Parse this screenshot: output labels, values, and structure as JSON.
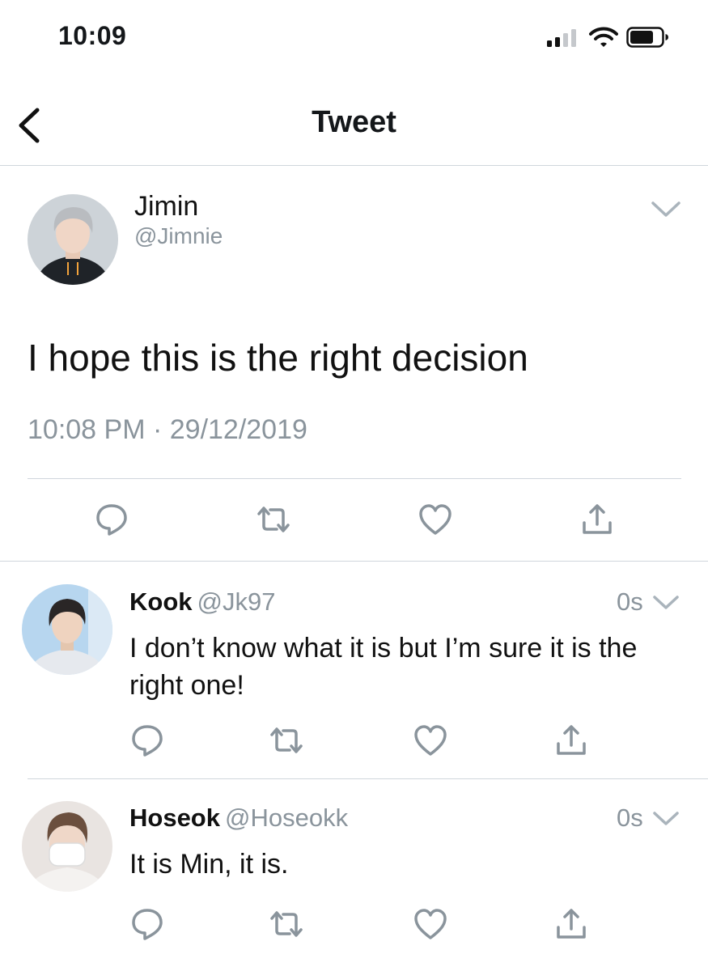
{
  "status_bar": {
    "time": "10:09"
  },
  "nav": {
    "title": "Tweet"
  },
  "tweet": {
    "author_name": "Jimin",
    "author_handle": "@Jimnie",
    "text": "I hope this is the right decision",
    "timestamp": "10:08 PM · 29/12/2019"
  },
  "replies": [
    {
      "name": "Kook",
      "handle": "@Jk97",
      "time": "0s",
      "text": "I don’t know what it is but I’m sure it is the right one!"
    },
    {
      "name": "Hoseok",
      "handle": "@Hoseokk",
      "time": "0s",
      "text": "It is Min, it is."
    }
  ],
  "icons": {
    "reply": "reply-icon",
    "retweet": "retweet-icon",
    "like": "heart-icon",
    "share": "share-icon",
    "caret": "chevron-down-icon",
    "back": "back-arrow-icon"
  },
  "colors": {
    "text": "#14171a",
    "secondary": "#8a949c",
    "icon": "#8a949c",
    "divider": "#cfd6dc"
  }
}
